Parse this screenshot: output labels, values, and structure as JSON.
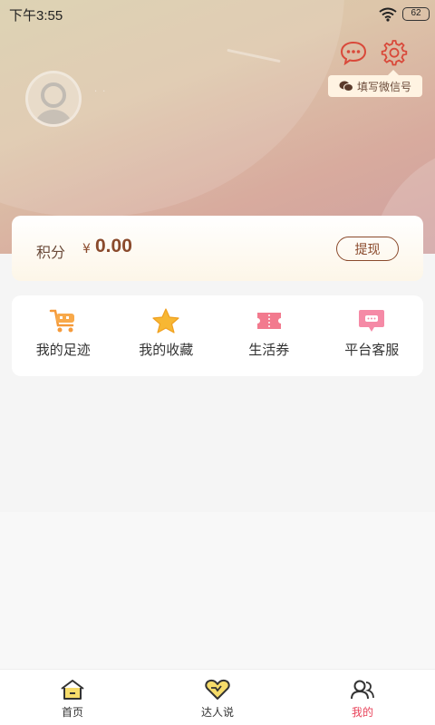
{
  "status_bar": {
    "time": "下午3:55",
    "battery": "62"
  },
  "header": {
    "wechat_tip": "填写微信号"
  },
  "points": {
    "label": "积分",
    "currency": "¥",
    "value": "0.00",
    "withdraw_label": "提现"
  },
  "menu": {
    "items": [
      {
        "label": "我的足迹",
        "icon": "cart-icon"
      },
      {
        "label": "我的收藏",
        "icon": "star-icon"
      },
      {
        "label": "生活券",
        "icon": "ticket-icon"
      },
      {
        "label": "平台客服",
        "icon": "chat-bubble-icon"
      }
    ]
  },
  "tabbar": {
    "items": [
      {
        "label": "首页",
        "icon": "home-icon"
      },
      {
        "label": "达人说",
        "icon": "heart-icon"
      },
      {
        "label": "我的",
        "icon": "user-icon",
        "active": true
      }
    ]
  },
  "colors": {
    "accent": "#e8435a",
    "brown": "#8a4a2c",
    "icon_red": "#d9493a"
  }
}
